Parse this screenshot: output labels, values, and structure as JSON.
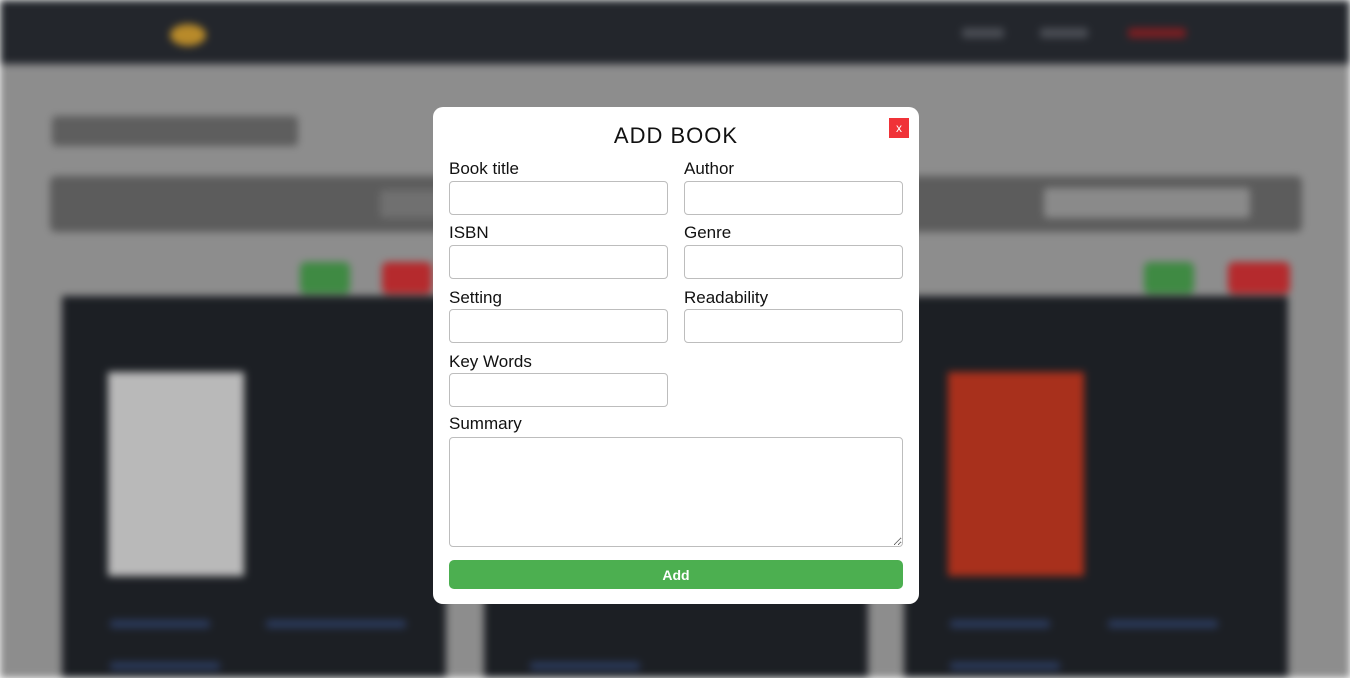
{
  "modal": {
    "title": "ADD BOOK",
    "close_label": "x",
    "fields": {
      "book_title": {
        "label": "Book title",
        "value": ""
      },
      "author": {
        "label": "Author",
        "value": ""
      },
      "isbn": {
        "label": "ISBN",
        "value": ""
      },
      "genre": {
        "label": "Genre",
        "value": ""
      },
      "setting": {
        "label": "Setting",
        "value": ""
      },
      "readability": {
        "label": "Readability",
        "value": ""
      },
      "key_words": {
        "label": "Key Words",
        "value": ""
      },
      "summary": {
        "label": "Summary",
        "value": ""
      }
    },
    "submit_label": "Add"
  },
  "colors": {
    "close_button": "#f03238",
    "add_button": "#4caf50",
    "navbar": "#23262c",
    "overlay": "#8d8d8d"
  }
}
